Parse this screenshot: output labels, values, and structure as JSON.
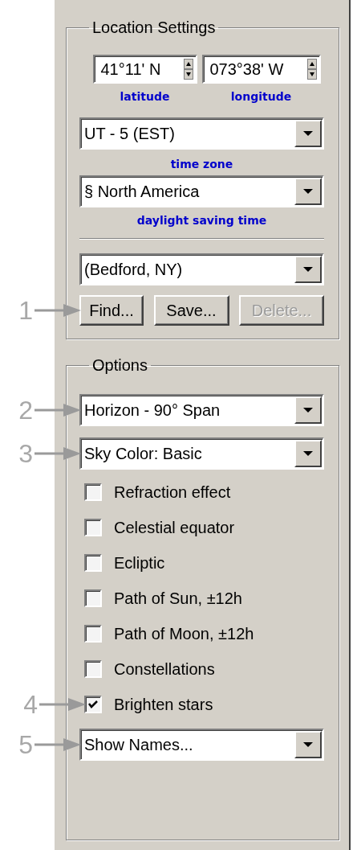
{
  "location_settings": {
    "title": "Location Settings",
    "latitude": {
      "value": "41°11' N",
      "label": "latitude"
    },
    "longitude": {
      "value": "073°38' W",
      "label": "longitude"
    },
    "time_zone": {
      "value": "UT - 5 (EST)",
      "label": "time zone"
    },
    "daylight_saving_time": {
      "value": "§ North America",
      "label": "daylight saving time"
    },
    "location": {
      "value": "(Bedford, NY)"
    },
    "buttons": [
      {
        "label": "Find...",
        "disabled": false,
        "callout": "1"
      },
      {
        "label": "Save...",
        "disabled": false
      },
      {
        "label": "Delete...",
        "disabled": true
      }
    ]
  },
  "options": {
    "title": "Options",
    "view": {
      "value": "Horizon - 90° Span",
      "callout": "2"
    },
    "sky_color": {
      "value": "Sky Color: Basic",
      "callout": "3"
    },
    "checkboxes": [
      {
        "label": "Refraction effect",
        "checked": false
      },
      {
        "label": "Celestial equator",
        "checked": false
      },
      {
        "label": "Ecliptic",
        "checked": false
      },
      {
        "label": "Path of Sun, ±12h",
        "checked": false
      },
      {
        "label": "Path of Moon, ±12h",
        "checked": false
      },
      {
        "label": "Constellations",
        "checked": false
      },
      {
        "label": "Brighten stars",
        "checked": true,
        "callout": "4"
      }
    ],
    "names": {
      "value": "Show Names...",
      "callout": "5"
    }
  }
}
